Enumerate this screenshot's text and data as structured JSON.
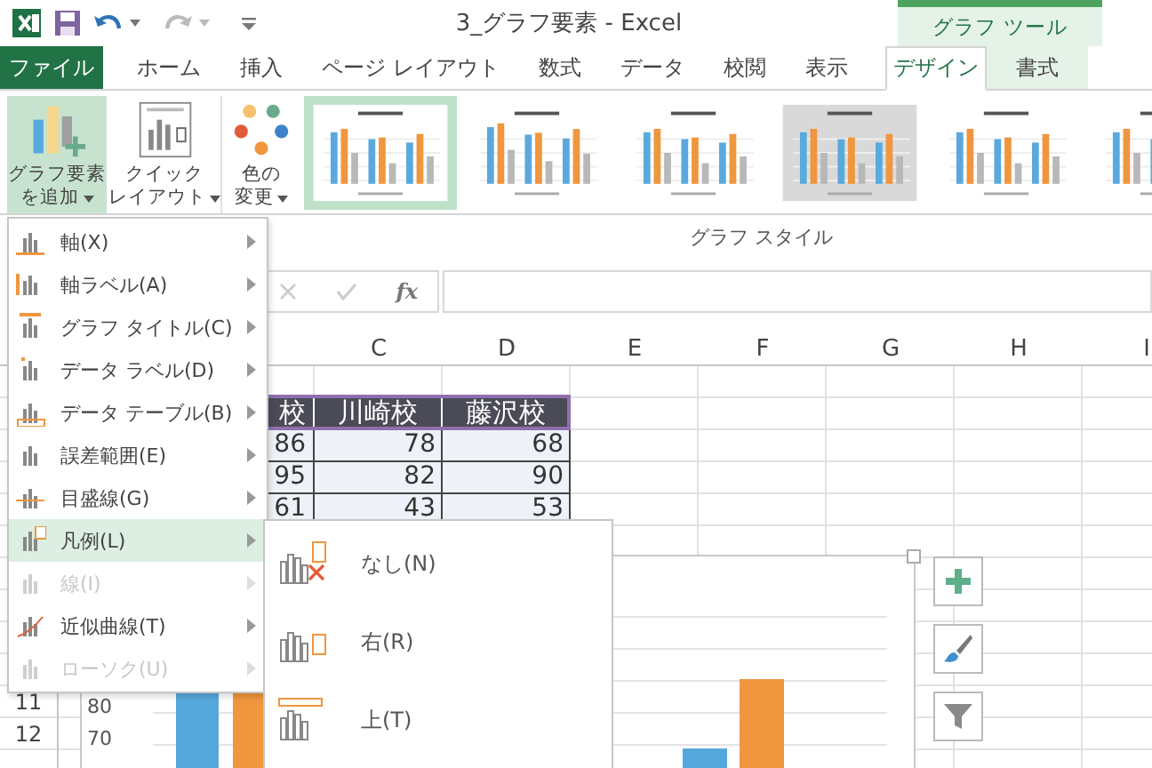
{
  "title_bar": {
    "title": "3_グラフ要素 - Excel",
    "context_group": "グラフ ツール"
  },
  "tabs": [
    {
      "label": "ファイル",
      "kind": "file",
      "selected": false
    },
    {
      "label": "ホーム",
      "kind": "normal",
      "selected": false
    },
    {
      "label": "挿入",
      "kind": "normal",
      "selected": false
    },
    {
      "label": "ページ レイアウト",
      "kind": "normal",
      "selected": false
    },
    {
      "label": "数式",
      "kind": "normal",
      "selected": false
    },
    {
      "label": "データ",
      "kind": "normal",
      "selected": false
    },
    {
      "label": "校閲",
      "kind": "normal",
      "selected": false
    },
    {
      "label": "表示",
      "kind": "normal",
      "selected": false
    },
    {
      "label": "デザイン",
      "kind": "context",
      "selected": true
    },
    {
      "label": "書式",
      "kind": "context",
      "selected": false
    }
  ],
  "ribbon": {
    "buttons": [
      {
        "lines": [
          "グラフ要素",
          "を追加"
        ],
        "selected": true
      },
      {
        "lines": [
          "クイック",
          "レイアウト"
        ],
        "selected": false
      },
      {
        "lines": [
          "色の",
          "変更"
        ],
        "selected": false
      }
    ],
    "styles": [
      {
        "selected": true
      },
      {
        "selected": false
      },
      {
        "selected": false
      },
      {
        "selected": false
      },
      {
        "selected": false
      },
      {
        "selected": false
      }
    ],
    "group_label": "グラフ スタイル"
  },
  "formula_bar": {
    "function_label": "fx"
  },
  "sheet": {
    "columns": [
      "C",
      "D",
      "E",
      "F",
      "G",
      "H",
      "I"
    ],
    "row_numbers": [
      "11",
      "12"
    ],
    "table": {
      "header": [
        "校",
        "川崎校",
        "藤沢校"
      ],
      "rows": [
        [
          "86",
          "78",
          "68"
        ],
        [
          "95",
          "82",
          "90"
        ],
        [
          "61",
          "43",
          "53"
        ]
      ]
    }
  },
  "chart": {
    "axis_labels": [
      "80",
      "70"
    ]
  },
  "menu": {
    "items": [
      {
        "label": "軸(X)",
        "disabled": false,
        "selected": false
      },
      {
        "label": "軸ラベル(A)",
        "disabled": false,
        "selected": false
      },
      {
        "label": "グラフ タイトル(C)",
        "disabled": false,
        "selected": false
      },
      {
        "label": "データ ラベル(D)",
        "disabled": false,
        "selected": false
      },
      {
        "label": "データ テーブル(B)",
        "disabled": false,
        "selected": false
      },
      {
        "label": "誤差範囲(E)",
        "disabled": false,
        "selected": false
      },
      {
        "label": "目盛線(G)",
        "disabled": false,
        "selected": false
      },
      {
        "label": "凡例(L)",
        "disabled": false,
        "selected": true
      },
      {
        "label": "線(I)",
        "disabled": true,
        "selected": false
      },
      {
        "label": "近似曲線(T)",
        "disabled": false,
        "selected": false
      },
      {
        "label": "ローソク(U)",
        "disabled": true,
        "selected": false
      }
    ]
  },
  "submenu": {
    "items": [
      {
        "label": "なし(N)"
      },
      {
        "label": "右(R)"
      },
      {
        "label": "上(T)"
      }
    ]
  }
}
